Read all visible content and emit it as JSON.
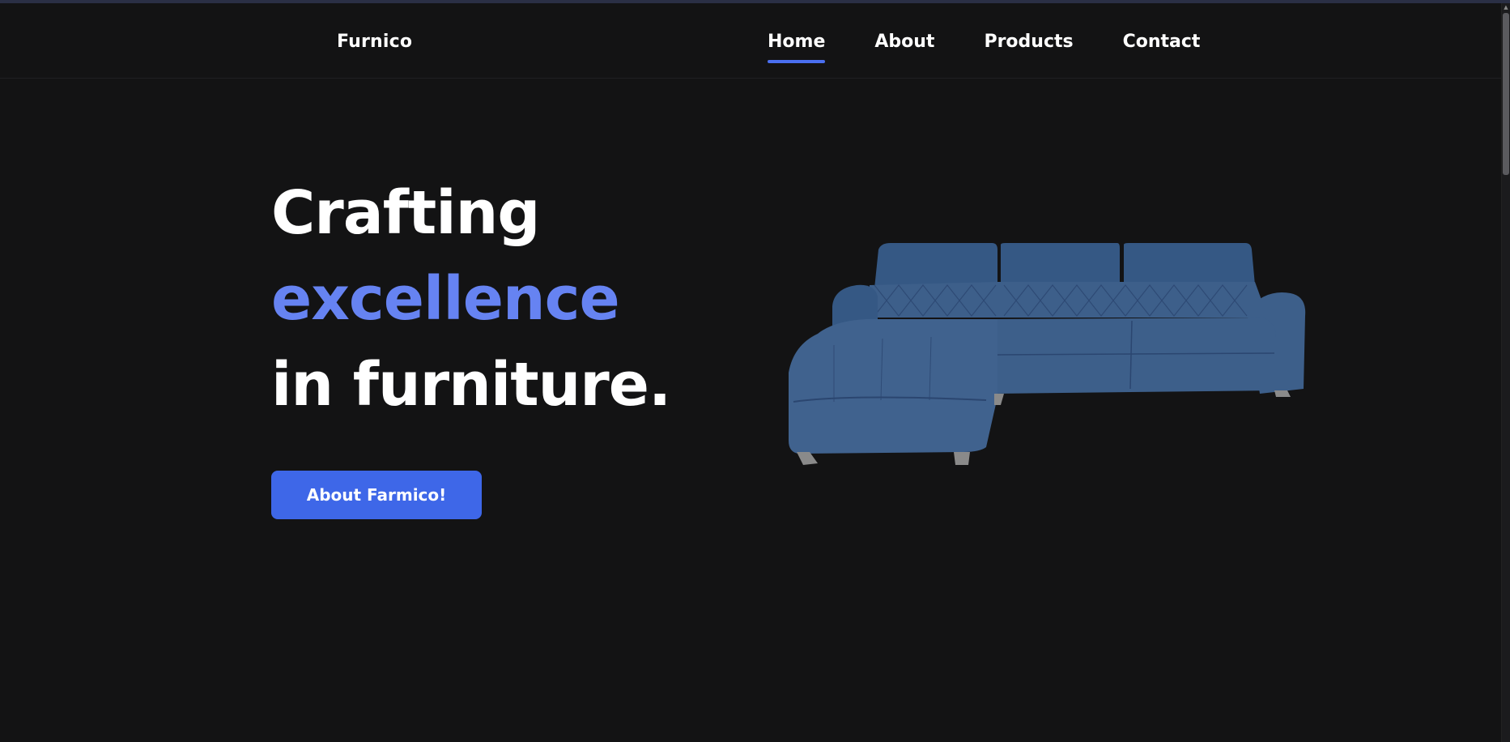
{
  "brand": {
    "name": "Furnico"
  },
  "nav": {
    "links": [
      {
        "label": "Home",
        "active": true
      },
      {
        "label": "About",
        "active": false
      },
      {
        "label": "Products",
        "active": false
      },
      {
        "label": "Contact",
        "active": false
      }
    ]
  },
  "hero": {
    "line1": "Crafting",
    "line2": "excellence",
    "line3": "in furniture.",
    "cta_label": "About Farmico!"
  },
  "images": {
    "hero_image": "sofa-icon"
  },
  "colors": {
    "background": "#131314",
    "accent": "#4a6ff0",
    "accent_text": "#6683f2",
    "button": "#3e67e8",
    "text": "#ffffff",
    "sofa": "#3d5f8a"
  }
}
